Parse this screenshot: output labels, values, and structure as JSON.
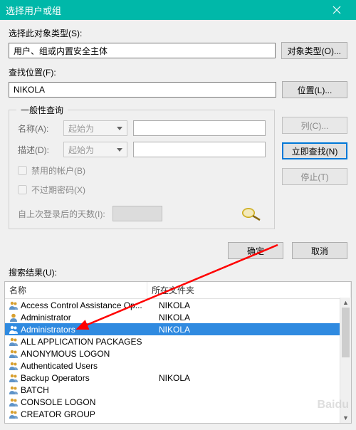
{
  "title": "选择用户或组",
  "labels": {
    "objectType": "选择此对象类型(S):",
    "objectTypeValue": "用户、组或内置安全主体",
    "objectTypesBtn": "对象类型(O)...",
    "location": "查找位置(F):",
    "locationValue": "NIKOLA",
    "locationsBtn": "位置(L)...",
    "commonQueries": "一般性查询",
    "name": "名称(A):",
    "desc": "描述(D):",
    "startsWith": "起始为",
    "disabledAccounts": "禁用的帐户(B)",
    "nonExpiring": "不过期密码(X)",
    "daysSince": "自上次登录后的天数(I):",
    "columnsBtn": "列(C)...",
    "findNowBtn": "立即查找(N)",
    "stopBtn": "停止(T)",
    "ok": "确定",
    "cancel": "取消",
    "searchResults": "搜索结果(U):",
    "colName": "名称",
    "colFolder": "所在文件夹"
  },
  "results": [
    {
      "name": "Access Control Assistance Op...",
      "folder": "NIKOLA",
      "type": "group"
    },
    {
      "name": "Administrator",
      "folder": "NIKOLA",
      "type": "user"
    },
    {
      "name": "Administrators",
      "folder": "NIKOLA",
      "type": "group",
      "selected": true
    },
    {
      "name": "ALL APPLICATION PACKAGES",
      "folder": "",
      "type": "group"
    },
    {
      "name": "ANONYMOUS LOGON",
      "folder": "",
      "type": "group"
    },
    {
      "name": "Authenticated Users",
      "folder": "",
      "type": "group"
    },
    {
      "name": "Backup Operators",
      "folder": "NIKOLA",
      "type": "group"
    },
    {
      "name": "BATCH",
      "folder": "",
      "type": "group"
    },
    {
      "name": "CONSOLE LOGON",
      "folder": "",
      "type": "group"
    },
    {
      "name": "CREATOR GROUP",
      "folder": "",
      "type": "group"
    }
  ]
}
